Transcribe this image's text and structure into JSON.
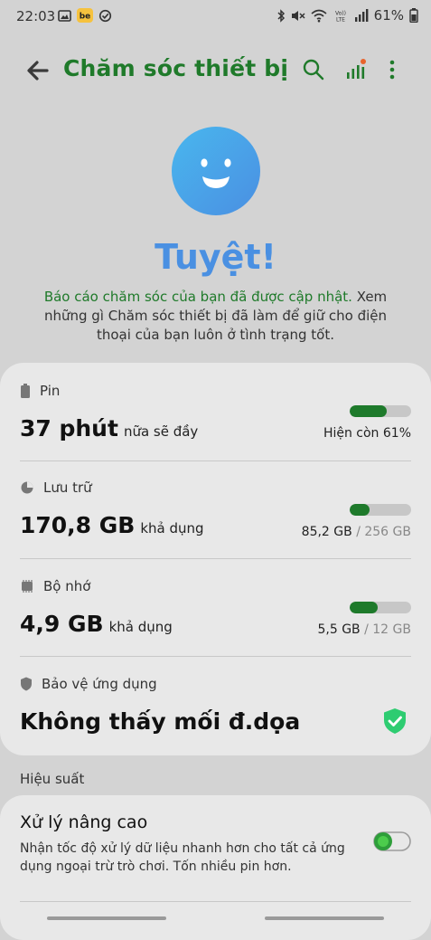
{
  "status_bar": {
    "time": "22:03",
    "battery": "61%",
    "net_label": "VoLTE"
  },
  "header": {
    "title": "Chăm sóc thiết bị"
  },
  "hero": {
    "title": "Tuyệt!",
    "desc_link": "Báo cáo chăm sóc của bạn đã được cập nhật.",
    "desc_rest": " Xem những gì Chăm sóc thiết bị đã làm để giữ cho điện thoại của bạn luôn ở tình trạng tốt."
  },
  "battery": {
    "label": "Pin",
    "value": "37 phút",
    "suffix": "nữa sẽ đầy",
    "note": "Hiện còn 61%",
    "level": 0.61
  },
  "storage": {
    "label": "Lưu trữ",
    "value": "170,8 GB",
    "suffix": "khả dụng",
    "used": "85,2 GB",
    "total": "/ 256 GB",
    "level": 0.33
  },
  "memory": {
    "label": "Bộ nhớ",
    "value": "4,9 GB",
    "suffix": "khả dụng",
    "used": "5,5 GB",
    "total": "/ 12 GB",
    "level": 0.46
  },
  "protection": {
    "label": "Bảo vệ ứng dụng",
    "value": "Không thấy mối đ.dọa"
  },
  "performance": {
    "section_label": "Hiệu suất",
    "title": "Xử lý nâng cao",
    "desc": "Nhận tốc độ xử lý dữ liệu nhanh hơn cho tất cả ứng dụng ngoại trừ trò chơi. Tốn nhiều pin hơn.",
    "enabled": true
  },
  "colors": {
    "accent_green": "#1e7a2b",
    "title_blue": "#4a90e2",
    "smiley_blue": "#4aa6e8"
  }
}
